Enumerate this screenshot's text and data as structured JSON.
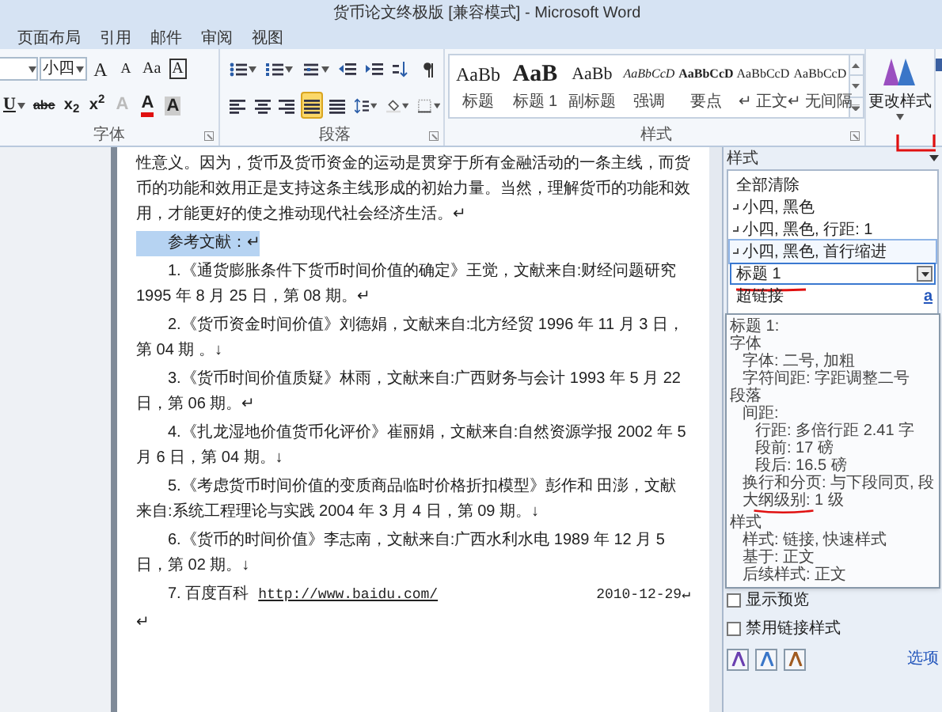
{
  "window": {
    "title": "货币论文终极版 [兼容模式] - Microsoft Word"
  },
  "ribbon_tabs": [
    {
      "label": "页面布局"
    },
    {
      "label": "引用"
    },
    {
      "label": "邮件"
    },
    {
      "label": "审阅"
    },
    {
      "label": "视图"
    }
  ],
  "font_group": {
    "label": "字体",
    "font_size": "小四",
    "row1_letters": [
      "A",
      "A",
      "Aa",
      "A"
    ],
    "row2_letters": [
      "U",
      "abc",
      "x$_{2}$",
      "x$^{2}$",
      "A",
      "A",
      "A"
    ]
  },
  "paragraph_group": {
    "label": "段落",
    "alignment": [
      {
        "selected": false
      },
      {
        "selected": false
      },
      {
        "selected": false
      },
      {
        "selected": true
      },
      {
        "selected": false
      }
    ]
  },
  "styles_group": {
    "label": "样式",
    "gallery": [
      {
        "preview": "AaBb",
        "name": "标题",
        "kind": "title"
      },
      {
        "preview": "AaB",
        "name": "标题 1",
        "kind": "heading"
      },
      {
        "preview": "AaBb",
        "name": "副标题",
        "kind": "subtitle"
      },
      {
        "preview": "AaBbCcD",
        "name": "强调",
        "kind": "emphasis"
      },
      {
        "preview": "AaBbCcD",
        "name": "要点",
        "kind": "strong"
      },
      {
        "preview": "AaBbCcD",
        "name": "正文",
        "kind": "normal",
        "mark": "↵"
      },
      {
        "preview": "AaBbCcD",
        "name": "无间隔",
        "kind": "normal",
        "mark": "↵"
      }
    ],
    "change_styles": "更改样式"
  },
  "document": {
    "paragraphs": [
      {
        "text": "性意义。因为，货币及货币资金的运动是贯穿于所有金融活动的一条主线，而货币的功能和效用正是支持这条主线形成的初始力量。当然，理解货币的功能和效用，才能更好的使之推动现代社会经济生活。↵",
        "indent": false,
        "highlighted": false
      },
      {
        "text": "参考文献：↵",
        "indent": true,
        "highlighted": true
      },
      {
        "text": "1.《通货膨胀条件下货币时间价值的确定》王觉，文献来自:财经问题研究 1995 年 8 月 25 日，第 08 期。↵",
        "indent": true,
        "highlighted": false
      },
      {
        "text": "2.《货币资金时间价值》刘德娟，文献来自:北方经贸 1996 年 11 月 3 日，第 04 期 。↓",
        "indent": true,
        "highlighted": false
      },
      {
        "text": "3.《货币时间价值质疑》林雨，文献来自:广西财务与会计 1993 年 5 月 22 日，第 06 期。↵",
        "indent": true,
        "highlighted": false
      },
      {
        "text": "4.《扎龙湿地价值货币化评价》崔丽娟，文献来自:自然资源学报 2002 年 5 月 6 日，第 04 期。↓",
        "indent": true,
        "highlighted": false
      },
      {
        "text": "5.《考虑货币时间价值的变质商品临时价格折扣模型》彭作和 田澎，文献来自:系统工程理论与实践 2004 年 3 月 4 日，第 09 期。↓",
        "indent": true,
        "highlighted": false
      },
      {
        "text": "6.《货币的时间价值》李志南，文献来自:广西水利水电 1989 年 12 月 5 日，第 02 期。↓",
        "indent": true,
        "highlighted": false
      }
    ],
    "link_line": {
      "text": "7. 百度百科",
      "link": "http://www.baidu.com/",
      "date": "2010-12-29↵"
    },
    "end_mark": "↵"
  },
  "styles_pane": {
    "title": "样式",
    "items": [
      {
        "label": "全部清除",
        "kind": "clear",
        "selected": false,
        "hover": false
      },
      {
        "label": "小四, 黑色",
        "kind": "paragraph",
        "selected": false,
        "hover": false
      },
      {
        "label": "小四, 黑色, 行距: 1",
        "kind": "paragraph",
        "selected": false,
        "hover": false
      },
      {
        "label": "小四, 黑色, 首行缩进",
        "kind": "paragraph",
        "selected": false,
        "hover": true
      },
      {
        "label": "标题 1",
        "kind": "linked",
        "selected": true,
        "hover": false
      },
      {
        "label": "超链接",
        "kind": "character",
        "selected": false,
        "hover": false,
        "type_mark": "a"
      }
    ],
    "tooltip": [
      {
        "text": "标题 1:"
      },
      {
        "text": "字体",
        "children": [
          {
            "text": "字体: 二号, 加粗"
          },
          {
            "text": "字符间距: 字距调整二号"
          }
        ]
      },
      {
        "text": "段落",
        "children": [
          {
            "text": "间距:",
            "children": [
              {
                "text": "行距: 多倍行距 2.41 字"
              },
              {
                "text": "段前: 17 磅"
              },
              {
                "text": "段后: 16.5 磅"
              }
            ]
          },
          {
            "text": "换行和分页: 与下段同页, 段"
          },
          {
            "text": "大纲级别: 1 级"
          }
        ]
      },
      {
        "text": "样式",
        "children": [
          {
            "text": "样式: 链接, 快速样式"
          },
          {
            "text": "基于: 正文"
          },
          {
            "text": "后续样式: 正文"
          }
        ]
      }
    ],
    "options": [
      {
        "label": "显示预览",
        "checked": false
      },
      {
        "label": "禁用链接样式",
        "checked": false
      }
    ],
    "options_link": "选项"
  }
}
